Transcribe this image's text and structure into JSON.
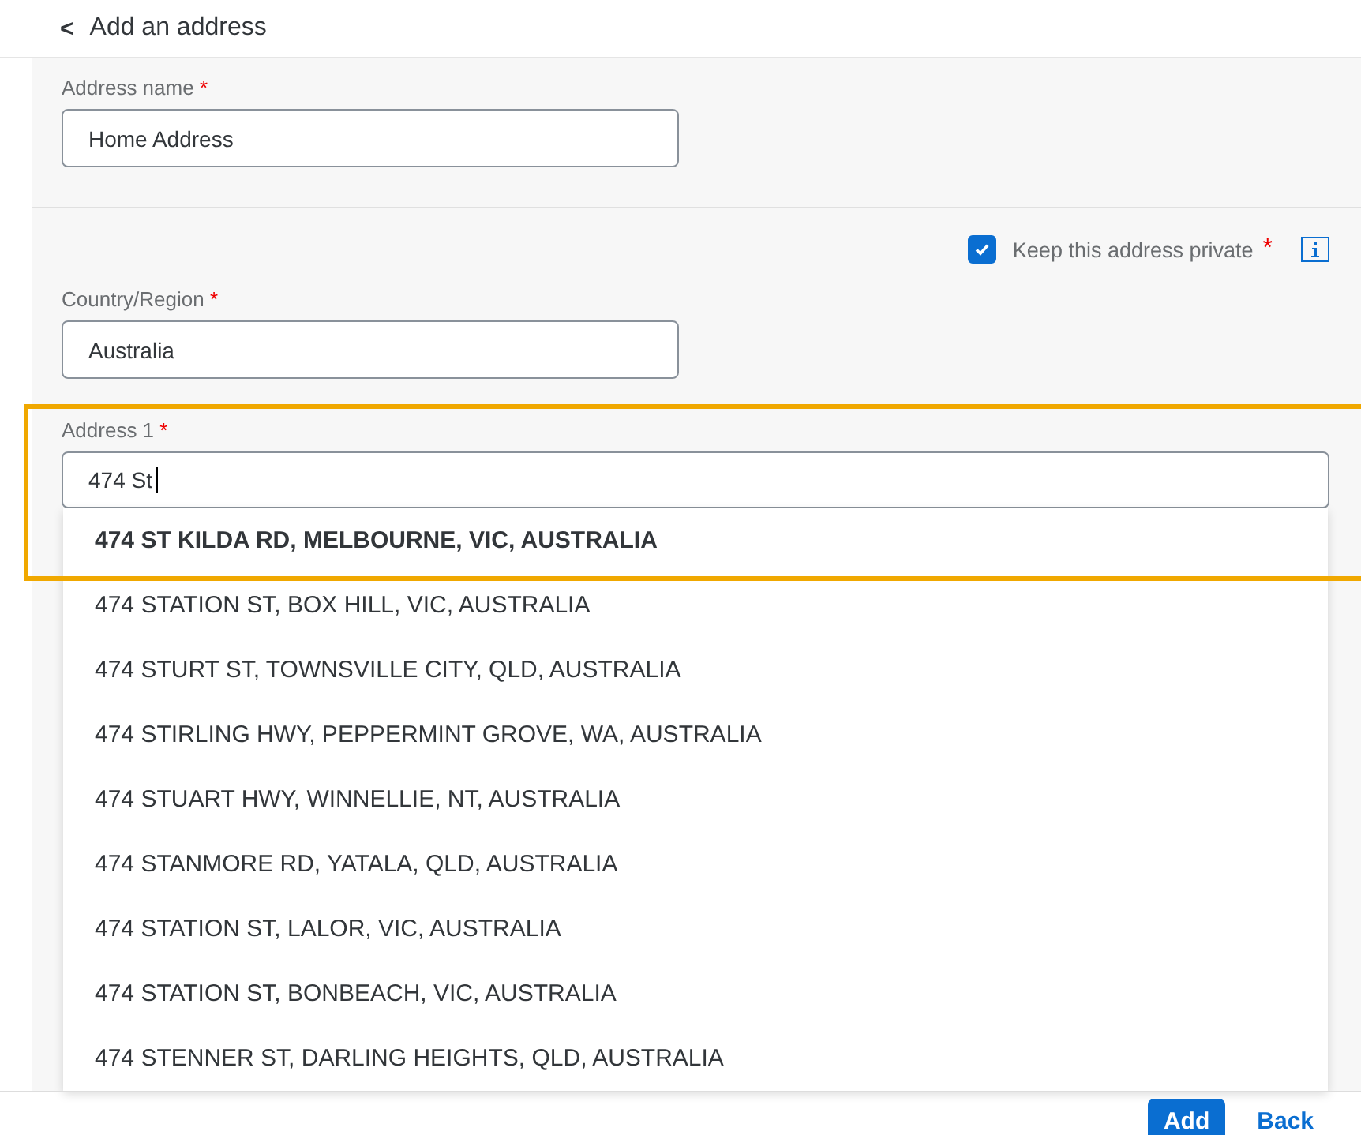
{
  "header": {
    "back_icon": "<",
    "title": "Add an address"
  },
  "address_name": {
    "label": "Address name",
    "required": "*",
    "value": "Home Address"
  },
  "private": {
    "label": "Keep this address private",
    "required": "*",
    "checked": true
  },
  "country": {
    "label": "Country/Region",
    "required": "*",
    "value": "Australia"
  },
  "address1": {
    "label": "Address 1",
    "required": "*",
    "value": "474 St"
  },
  "suggestions": [
    {
      "text": "474 ST KILDA RD, MELBOURNE, VIC, AUSTRALIA",
      "selected": true
    },
    {
      "text": "474 STATION ST, BOX HILL, VIC, AUSTRALIA",
      "selected": false
    },
    {
      "text": "474 STURT ST, TOWNSVILLE CITY, QLD, AUSTRALIA",
      "selected": false
    },
    {
      "text": "474 STIRLING HWY, PEPPERMINT GROVE, WA, AUSTRALIA",
      "selected": false
    },
    {
      "text": "474 STUART HWY, WINNELLIE, NT, AUSTRALIA",
      "selected": false
    },
    {
      "text": "474 STANMORE RD, YATALA, QLD, AUSTRALIA",
      "selected": false
    },
    {
      "text": "474 STATION ST, LALOR, VIC, AUSTRALIA",
      "selected": false
    },
    {
      "text": "474 STATION ST, BONBEACH, VIC, AUSTRALIA",
      "selected": false
    },
    {
      "text": "474 STENNER ST, DARLING HEIGHTS, QLD, AUSTRALIA",
      "selected": false
    }
  ],
  "buttons": {
    "add": "Add",
    "back": "Back"
  }
}
